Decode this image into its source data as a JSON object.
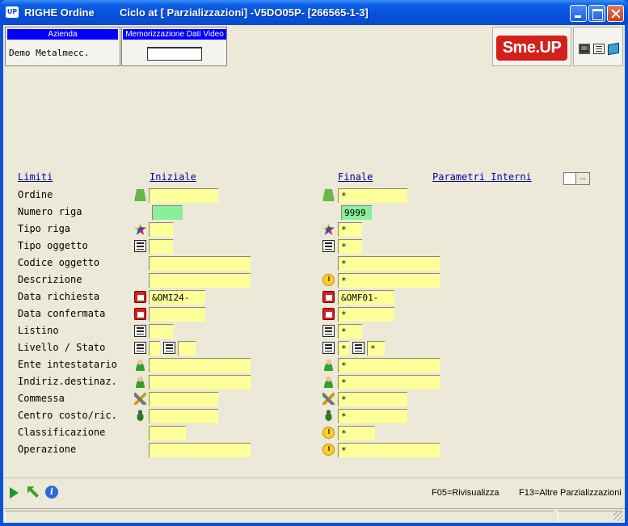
{
  "window": {
    "app_icon": "UP",
    "title_left": "RIGHE Ordine",
    "title_main": "Ciclo at [ Parzializzazioni] -V5DO05P- [266565-1-3]"
  },
  "header": {
    "azienda_label": "Azienda",
    "azienda_value": "Demo Metalmecc.",
    "memo_label": "Memorizzazione Dati Video",
    "memo_value": "",
    "logo_text": "Sme.UP",
    "tool_icons": [
      "monitor-icon",
      "document-icon",
      "book-icon"
    ]
  },
  "columns": {
    "limiti": "Limiti",
    "iniziale": "Iniziale",
    "finale": "Finale",
    "parametri": "Parametri Interni",
    "parametri_button": "..."
  },
  "rows": [
    {
      "label": "Ordine",
      "icon": "arrow-icon",
      "ini": "",
      "fin": "*"
    },
    {
      "label": "Numero riga",
      "icon": "",
      "ini": "",
      "fin": "9999"
    },
    {
      "label": "Tipo riga",
      "icon": "star-icon",
      "ini": "",
      "fin": "*"
    },
    {
      "label": "Tipo oggetto",
      "icon": "list-icon",
      "ini": "",
      "fin": "*"
    },
    {
      "label": "Codice oggetto",
      "icon": "",
      "ini": "",
      "fin": "*"
    },
    {
      "label": "Descrizione",
      "icon": "clock-icon",
      "ini": "",
      "fin": "*"
    },
    {
      "label": "Data richiesta",
      "icon": "calendar-icon",
      "ini": "&OMI24-",
      "fin": "&OMF01-"
    },
    {
      "label": "Data confermata",
      "icon": "calendar-icon",
      "ini": "",
      "fin": "*"
    },
    {
      "label": "Listino",
      "icon": "list-icon",
      "ini": "",
      "fin": "*"
    },
    {
      "label": "Livello / Stato",
      "icon": "list-icon",
      "ini": "",
      "ini2": "",
      "fin": "*",
      "fin2": "*"
    },
    {
      "label": "Ente intestatario",
      "icon": "person-icon",
      "ini": "",
      "fin": "*"
    },
    {
      "label": "Indiriz.destinaz.",
      "icon": "person-icon",
      "ini": "",
      "fin": "*"
    },
    {
      "label": "Commessa",
      "icon": "tool-icon",
      "ini": "",
      "fin": "*"
    },
    {
      "label": "Centro costo/ric.",
      "icon": "bug-icon",
      "ini": "",
      "fin": "*"
    },
    {
      "label": "Classificazione",
      "icon": "clock-icon",
      "ini": "",
      "fin": "*"
    },
    {
      "label": "Operazione",
      "icon": "clock-icon",
      "ini": "",
      "fin": "*"
    }
  ],
  "footer": {
    "f05": "F05=Rivisualizza",
    "f13": "F13=Altre Parzializzazioni",
    "info": "i"
  },
  "colors": {
    "field_yellow": "#ffff99",
    "field_green": "#8aee9a",
    "header_blue": "#0000ff",
    "logo_red": "#d3201a"
  }
}
